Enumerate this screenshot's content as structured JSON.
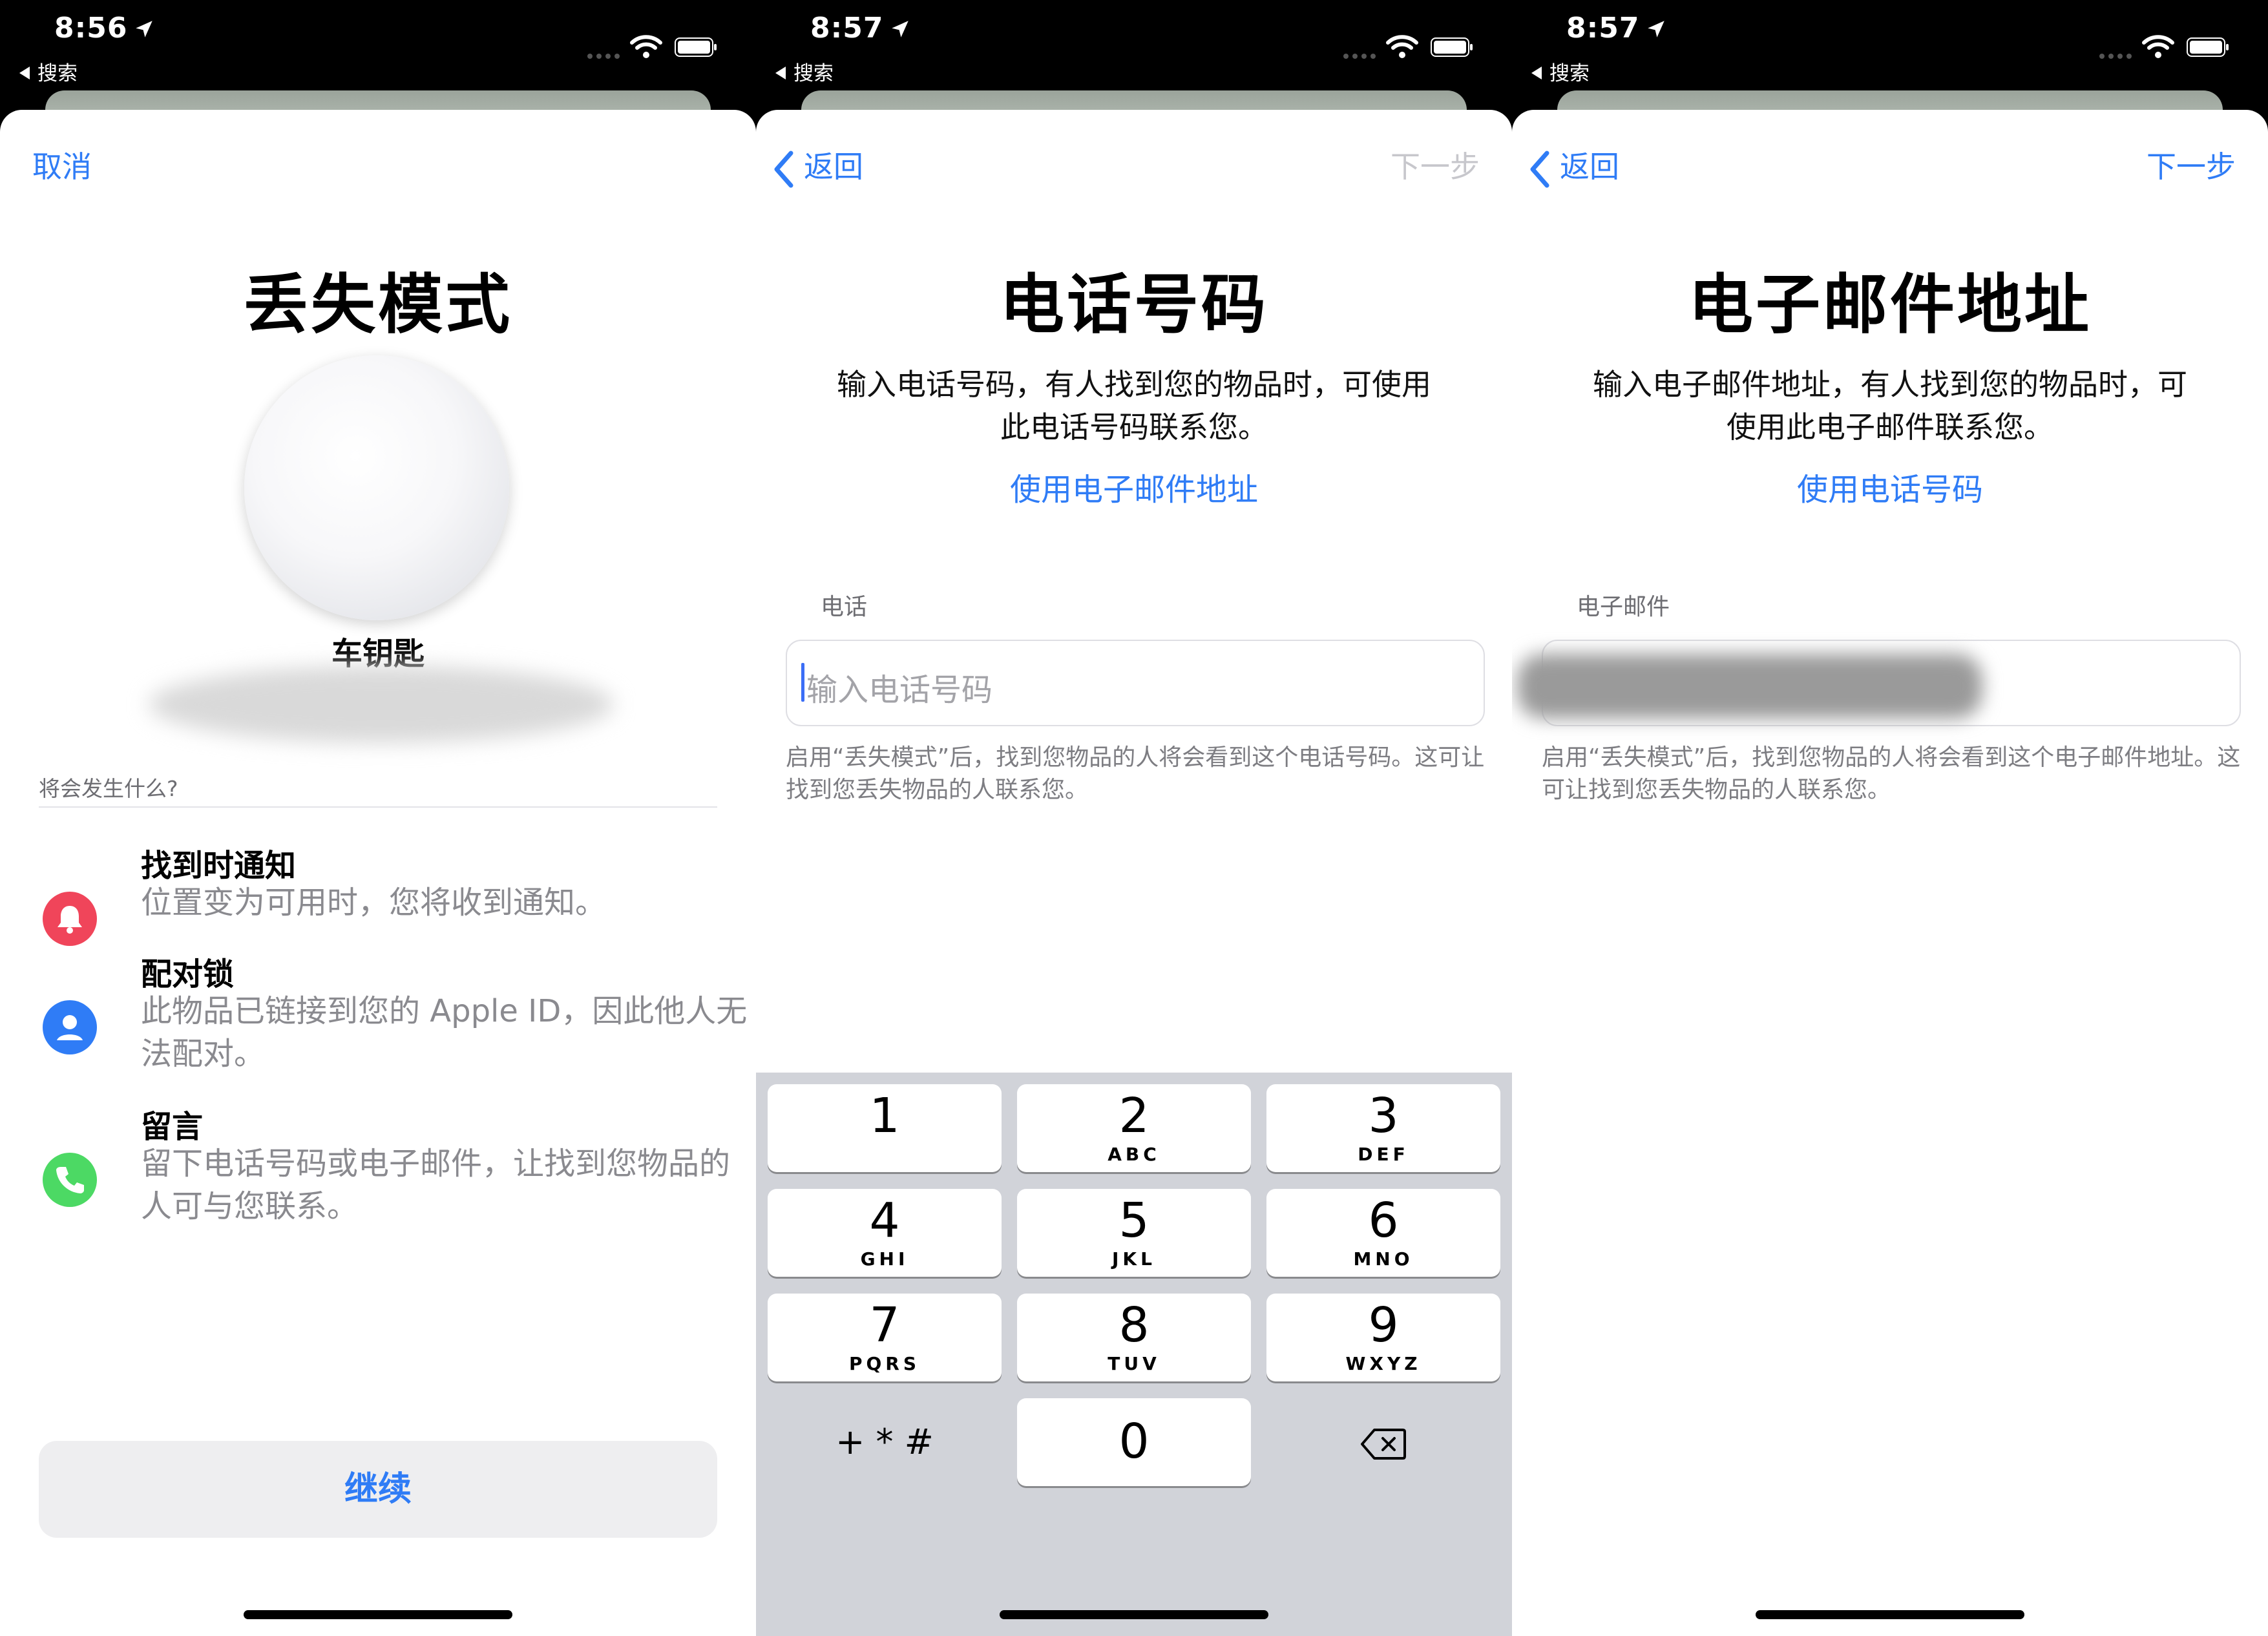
{
  "status_bars": [
    {
      "time": "8:56",
      "back_label": "搜索"
    },
    {
      "time": "8:57",
      "back_label": "搜索"
    },
    {
      "time": "8:57",
      "back_label": "搜索"
    }
  ],
  "lost_mode_screen": {
    "cancel": "取消",
    "title": "丢失模式",
    "item_name": "车钥匙",
    "section_label": "将会发生什么?",
    "features": [
      {
        "icon": "bell-icon",
        "color": "#f0455a",
        "title": "找到时通知",
        "desc": "位置变为可用时，您将收到通知。"
      },
      {
        "icon": "person-icon",
        "color": "#2f7cf6",
        "title": "配对锁",
        "desc": "此物品已链接到您的 Apple ID，因此他人无法配对。"
      },
      {
        "icon": "phone-icon",
        "color": "#4cd964",
        "title": "留言",
        "desc": "留下电话号码或电子邮件，让找到您物品的人可与您联系。"
      }
    ],
    "continue": "继续"
  },
  "phone_screen": {
    "back": "返回",
    "next": "下一步",
    "title": "电话号码",
    "desc": "输入电话号码，有人找到您的物品时，可使用此电话号码联系您。",
    "switch_link": "使用电子邮件地址",
    "field_label": "电话",
    "placeholder": "输入电话号码",
    "hint": "启用“丢失模式”后，找到您物品的人将会看到这个电话号码。这可让找到您丢失物品的人联系您。"
  },
  "email_screen": {
    "back": "返回",
    "next": "下一步",
    "title": "电子邮件地址",
    "desc": "输入电子邮件地址，有人找到您的物品时，可使用此电子邮件联系您。",
    "switch_link": "使用电话号码",
    "field_label": "电子邮件",
    "hint": "启用“丢失模式”后，找到您物品的人将会看到这个电子邮件地址。这可让找到您丢失物品的人联系您。"
  },
  "keypad": {
    "keys": [
      {
        "num": "1",
        "letters": ""
      },
      {
        "num": "2",
        "letters": "ABC"
      },
      {
        "num": "3",
        "letters": "DEF"
      },
      {
        "num": "4",
        "letters": "GHI"
      },
      {
        "num": "5",
        "letters": "JKL"
      },
      {
        "num": "6",
        "letters": "MNO"
      },
      {
        "num": "7",
        "letters": "PQRS"
      },
      {
        "num": "8",
        "letters": "TUV"
      },
      {
        "num": "9",
        "letters": "WXYZ"
      },
      {
        "num": "0",
        "letters": ""
      }
    ],
    "symbols": "+ * #"
  },
  "colors": {
    "accent": "#2f7cf6",
    "next_disabled": "#c7c7cc",
    "keypad_bg": "#d1d3d9"
  }
}
